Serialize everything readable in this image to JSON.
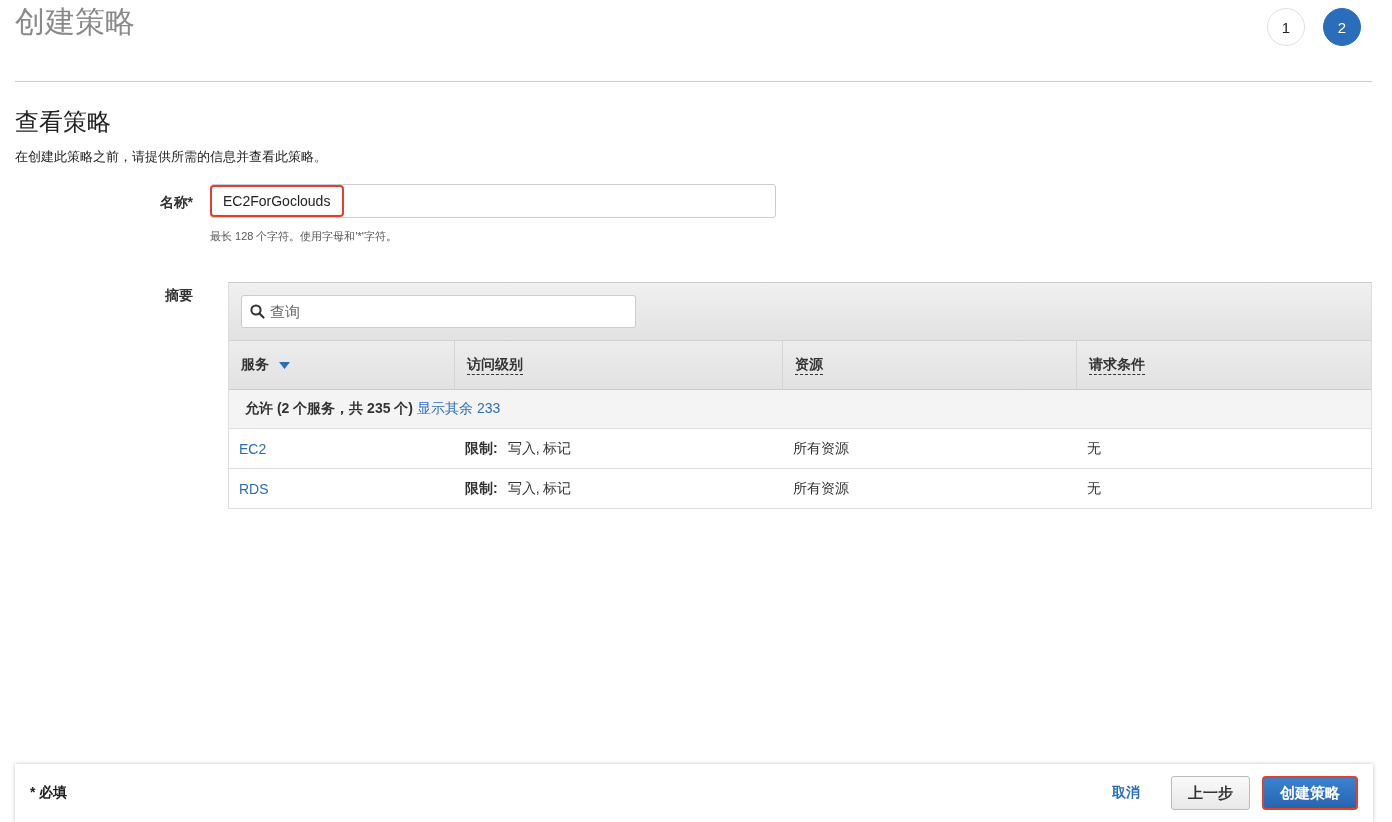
{
  "page_title": "创建策略",
  "steps": [
    {
      "label": "1",
      "selected": false
    },
    {
      "label": "2",
      "selected": true
    }
  ],
  "section": {
    "title": "查看策略",
    "description": "在创建此策略之前，请提供所需的信息并查看此策略。"
  },
  "name_field": {
    "label": "名称*",
    "value": "EC2ForGoclouds",
    "highlighted": true,
    "hint": "最长 128 个字符。使用字母和'*'字符。"
  },
  "summary": {
    "label": "摘要",
    "search": {
      "placeholder": "查询"
    },
    "columns": [
      {
        "label": "服务",
        "sorted": true
      },
      {
        "label": "访问级别",
        "sorted": false
      },
      {
        "label": "资源",
        "sorted": false
      },
      {
        "label": "请求条件",
        "sorted": false
      }
    ],
    "group": {
      "label": "允许 (2 个服务，共 235 个)",
      "link": "显示其余 233"
    },
    "rows": [
      {
        "service": "EC2",
        "access_label": "限制:",
        "access": "写入, 标记",
        "resource": "所有资源",
        "condition": "无"
      },
      {
        "service": "RDS",
        "access_label": "限制:",
        "access": "写入, 标记",
        "resource": "所有资源",
        "condition": "无"
      }
    ]
  },
  "footer": {
    "required_note": "* 必填",
    "cancel": "取消",
    "back": "上一步",
    "create": {
      "label": "创建策略",
      "highlighted": true
    }
  }
}
